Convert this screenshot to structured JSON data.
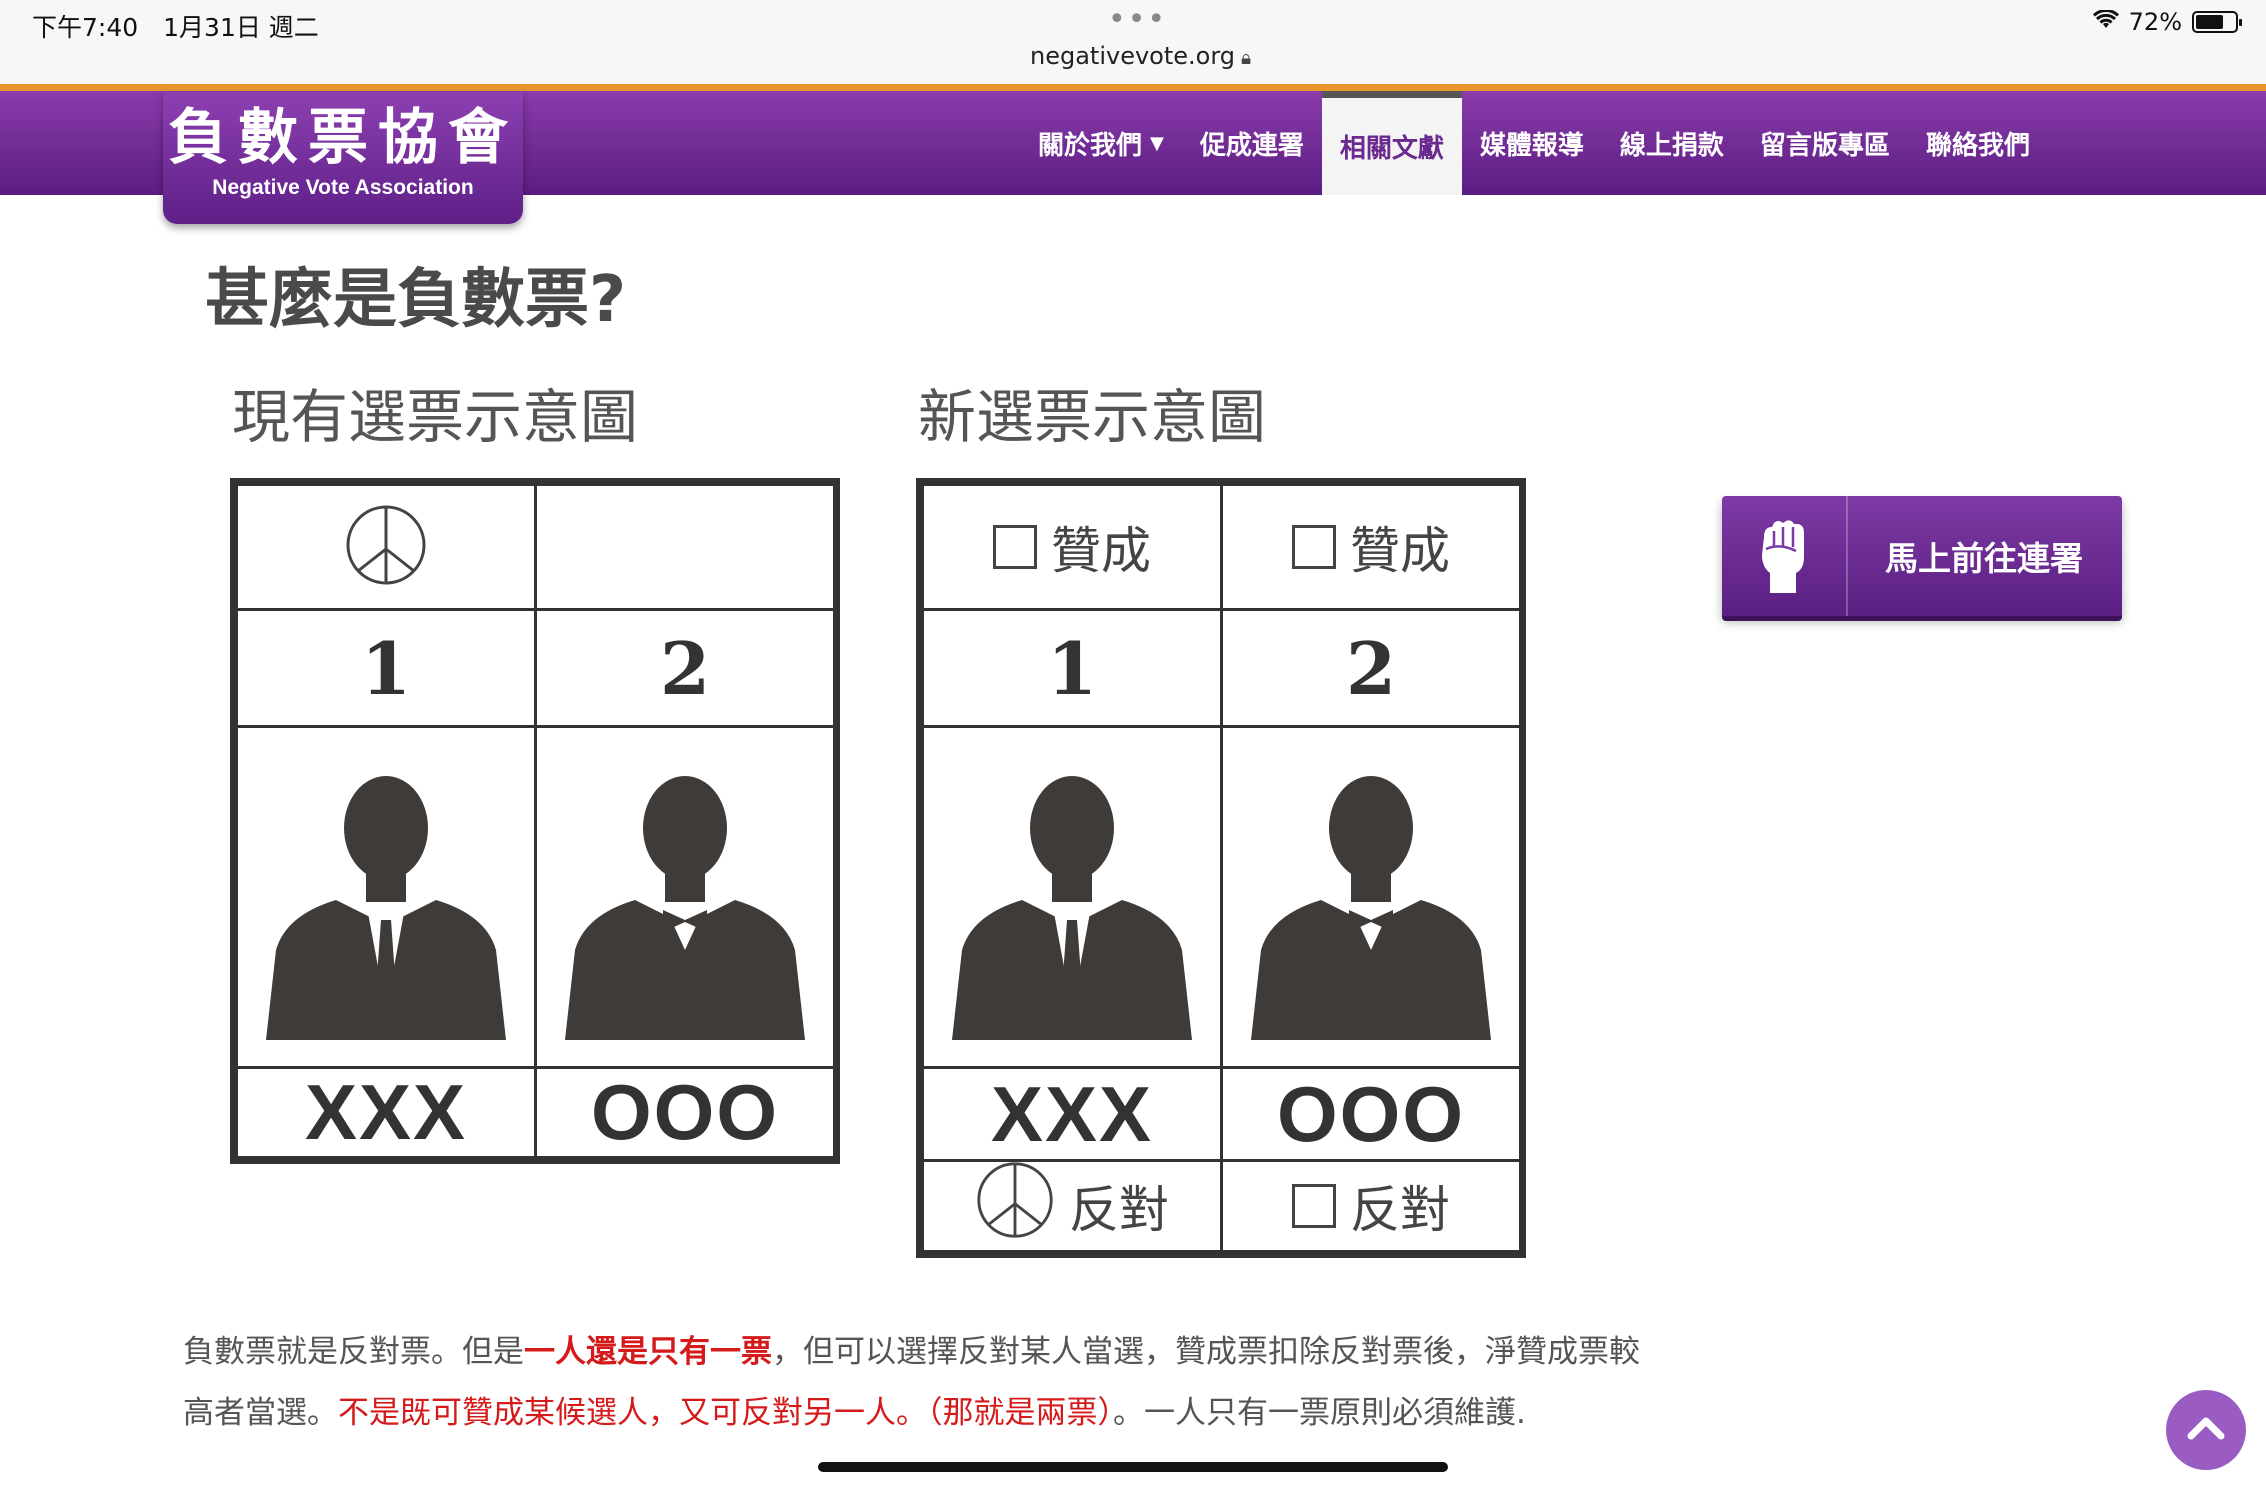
{
  "status_bar": {
    "time": "下午7:40　1月31日 週二",
    "dots": "•••",
    "url": "negativevote.org",
    "battery": "72%",
    "battery_level": 0.72,
    "icons": [
      "wifi-icon",
      "battery-icon",
      "lock-icon"
    ]
  },
  "logo": {
    "chinese": "負數票協會",
    "english": "Negative Vote Association"
  },
  "nav": {
    "items": [
      {
        "label": "關於我們",
        "has_dropdown": true
      },
      {
        "label": "促成連署"
      },
      {
        "label": "相關文獻",
        "active": true
      },
      {
        "label": "媒體報導"
      },
      {
        "label": "線上捐款"
      },
      {
        "label": "留言版專區"
      },
      {
        "label": "聯絡我們"
      }
    ]
  },
  "page": {
    "title": "甚麼是負數票?"
  },
  "ballots": {
    "current": {
      "heading": "現有選票示意圖",
      "numbers": [
        "1",
        "2"
      ],
      "names": [
        "XXX",
        "OOO"
      ]
    },
    "new": {
      "heading": "新選票示意圖",
      "approve_label": "贊成",
      "oppose_label": "反對",
      "numbers": [
        "1",
        "2"
      ],
      "names": [
        "XXX",
        "OOO"
      ]
    }
  },
  "sign_button": {
    "label": "馬上前往連署"
  },
  "intro": {
    "p1": "負數票就是反對票。但是",
    "p1_highlight": "一人還是只有一票",
    "p2": "，但可以選擇反對某人當選，贊成票扣除反對票後，淨贊成票較高者當選。",
    "p2_highlight": "不是既可贊成某候選人，又可反對另一人。（那就是兩票）",
    "p3": "。一人只有一票原則必須維護."
  },
  "colors": {
    "brand_purple": "#6a2a90",
    "accent_orange": "#e9962d",
    "highlight_red": "#d41a1a"
  }
}
